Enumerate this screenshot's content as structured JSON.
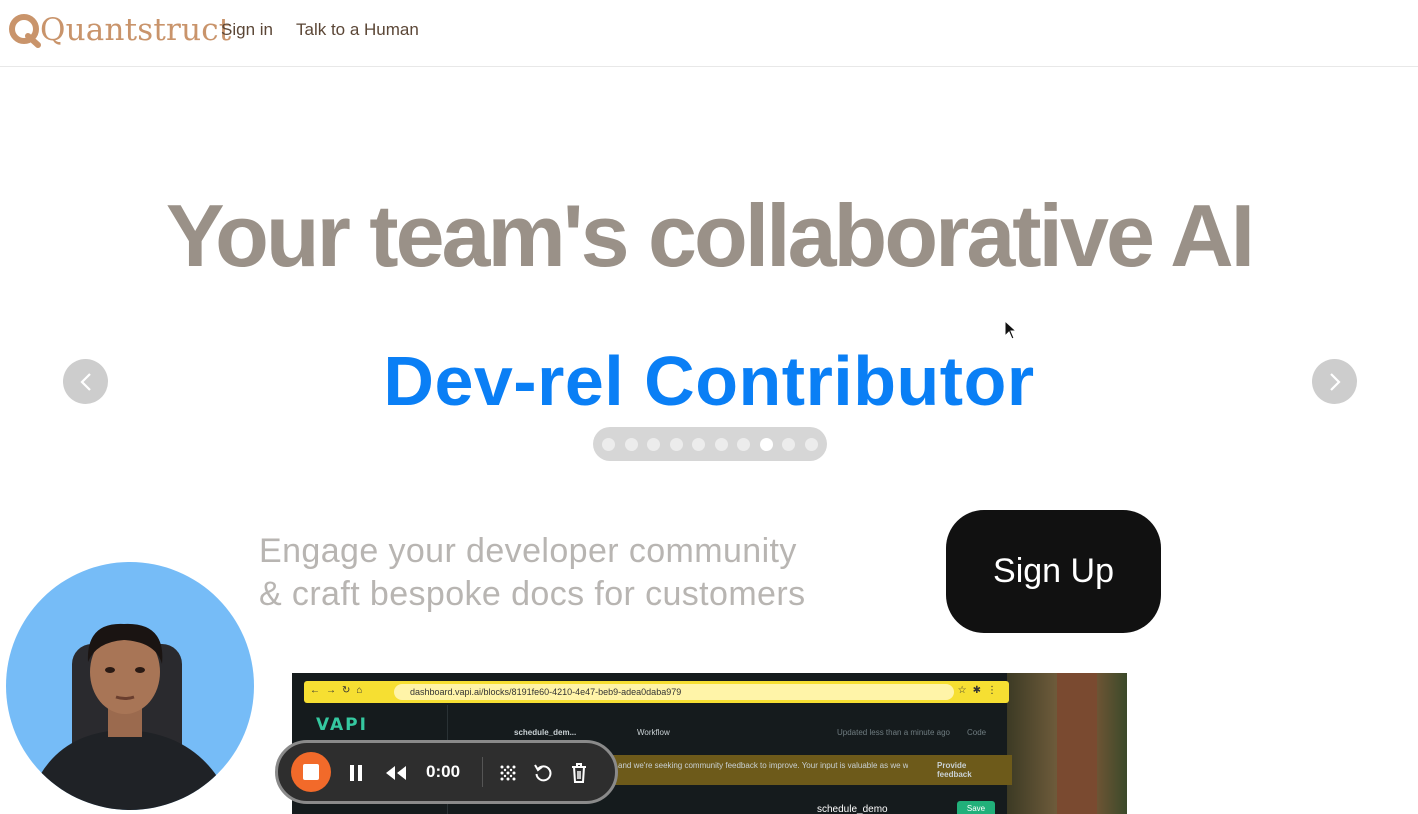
{
  "header": {
    "brand": "Quantstruct",
    "nav": [
      {
        "label": "Sign in"
      },
      {
        "label": "Talk to a Human"
      }
    ]
  },
  "hero": {
    "title": "Your team's collaborative AI",
    "role": "Dev-rel Contributor",
    "carousel": {
      "total": 10,
      "active_index": 7
    },
    "tagline_line1": "Engage your developer community",
    "tagline_line2": "& craft bespoke docs for customers",
    "cta": "Sign Up"
  },
  "video_preview": {
    "url": "dashboard.vapi.ai/blocks/8191fe60-4210-4e47-beb9-adea0daba979",
    "logo": "VAPI",
    "block_name": "schedule_dem...",
    "tab": "Workflow",
    "status": "Updated less than a minute ago",
    "code": "Code",
    "banner_text": "and we're seeking community feedback to improve. Your input is valuable as we work",
    "feedback": "Provide feedback",
    "name_field": "schedule_demo",
    "save": "Save"
  },
  "recorder": {
    "time": "0:00"
  },
  "colors": {
    "brand": "#c9946b",
    "title": "#9a9188",
    "accent": "#0a7ff5",
    "stop": "#f26a2a",
    "webcam_bg": "#76bcf7"
  }
}
